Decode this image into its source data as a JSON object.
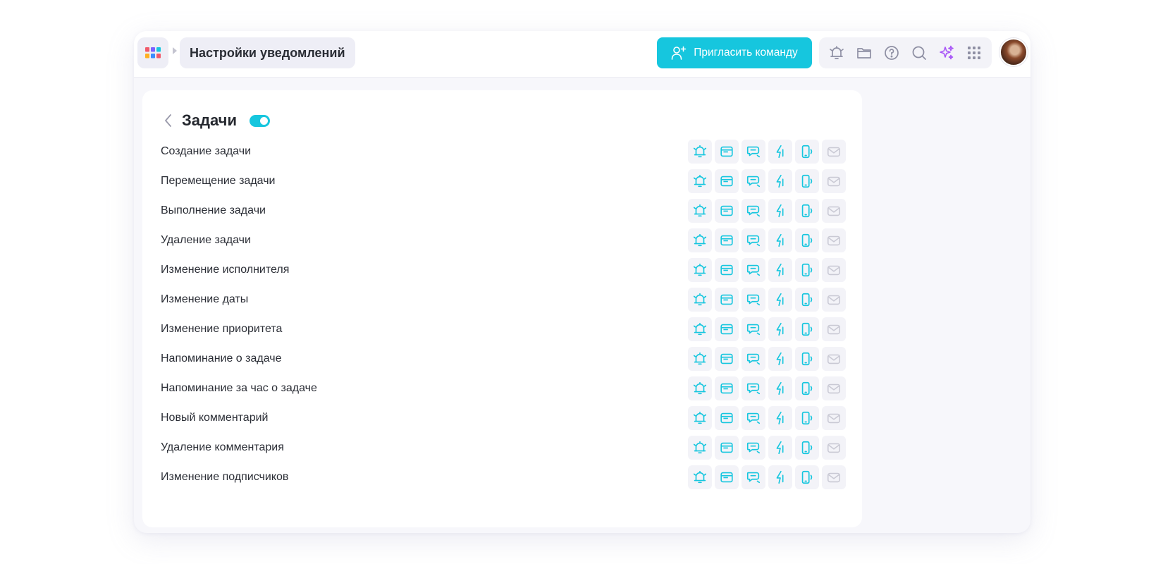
{
  "header": {
    "page_title": "Настройки уведомлений",
    "invite_label": "Пригласить команду"
  },
  "section": {
    "title": "Задачи",
    "enabled": true
  },
  "colors": {
    "accent": "#16c6de",
    "channel_off": "#c9c9d4",
    "ai_purple": "#a855f7"
  },
  "channel_icons": [
    "bell-icon",
    "browser-icon",
    "chat-icon",
    "bolt-icon",
    "mobile-icon",
    "mail-icon"
  ],
  "events": [
    {
      "label": "Создание задачи"
    },
    {
      "label": "Перемещение задачи"
    },
    {
      "label": "Выполнение задачи"
    },
    {
      "label": "Удаление задачи"
    },
    {
      "label": "Изменение исполнителя"
    },
    {
      "label": "Изменение даты"
    },
    {
      "label": "Изменение приоритета"
    },
    {
      "label": "Напоминание о задаче"
    },
    {
      "label": "Напоминание за час о задаче"
    },
    {
      "label": "Новый комментарий"
    },
    {
      "label": "Удаление комментария"
    },
    {
      "label": "Изменение подписчиков"
    }
  ]
}
